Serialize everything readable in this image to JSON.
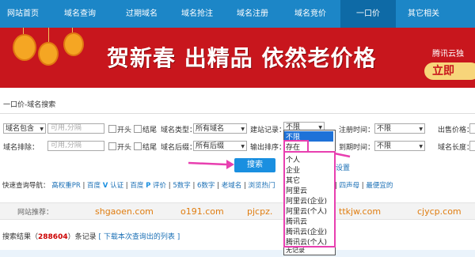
{
  "nav": {
    "items": [
      "网站首页",
      "域名查询",
      "过期域名",
      "域名抢注",
      "域名注册",
      "域名竞价",
      "一口价",
      "其它相关"
    ],
    "active": "一口价"
  },
  "banner": {
    "title": "贺新春 出精品 依然老价格",
    "ad_text": "腾讯云独",
    "cta": "立即"
  },
  "breadcrumb": "一口价-域名搜索",
  "filters": {
    "row1": {
      "domain_include_select": "域名包含",
      "domain_include_placeholder": "可用,分隔",
      "prefix_label": "开头",
      "suffix_label": "结尾",
      "domain_type_label": "域名类型：",
      "domain_type_value": "所有域名",
      "site_record_label": "建站记录：",
      "site_record_value": "不限",
      "reg_time_label": "注册时间：",
      "reg_time_value": "不限",
      "price_label": "出售价格："
    },
    "row2": {
      "domain_exclude_label": "域名排除：",
      "domain_exclude_placeholder": "可用,分隔",
      "prefix_label": "开头",
      "suffix_label": "结尾",
      "domain_suffix_label": "域名后缀：",
      "domain_suffix_value": "所有后缀",
      "output_sort_label": "输出排序：",
      "expire_time_label": "到期时间：",
      "expire_time_value": "不限",
      "domain_length_label": "域名长度："
    },
    "reset_link": "设置",
    "search_button": "搜索"
  },
  "site_record_options": [
    "不限",
    "存在",
    "个人",
    "企业",
    "其它",
    "阿里云",
    "阿里云(企业)",
    "阿里云(个人)",
    "腾讯云",
    "腾讯云(企业)",
    "腾讯云(个人)",
    "无记录"
  ],
  "quick_nav": {
    "label": "快速查询导航：",
    "links": [
      "高权重PR",
      "百度",
      "认证",
      "百度",
      "评价",
      "5数字",
      "6数字",
      "老域名",
      "浏览热门",
      "四声母",
      "最便宜的"
    ],
    "pipe_sep": "|"
  },
  "recommend": {
    "label": "网站推荐：",
    "sites": [
      "shgaoen.com",
      "o191.com",
      "pjcpz.",
      "ttkjw.com",
      "cjycp.com"
    ]
  },
  "results": {
    "prefix": "搜索结果（",
    "count": "288604",
    "suffix": "）条记录",
    "download_link": "[ 下载本次查询出的列表 ]"
  },
  "colors": {
    "nav_bg": "#1c86c7",
    "nav_active": "#0e6aa6",
    "banner_bg": "#c8161d",
    "link": "#1a6fb5",
    "highlight": "#e83fb0",
    "selected_option": "#1e72d8"
  }
}
